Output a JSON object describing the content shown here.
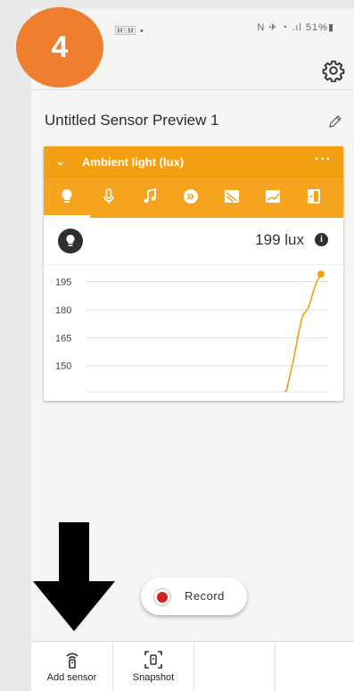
{
  "step_badge": "4",
  "status_bar": {
    "left": "🄼🄼 •",
    "right": "N ✈ ◔ .ıl 51%▮"
  },
  "preview": {
    "title": "Untitled Sensor Preview 1"
  },
  "sensor_card": {
    "title": "Ambient light (lux)",
    "more": "···",
    "tabs": [
      "light-bulb-icon",
      "microphone-icon",
      "music-note-icon",
      "pitch-icon",
      "linear-accel-icon",
      "accelerometer-icon",
      "magnetometer-icon"
    ],
    "reading": "199 lux",
    "info": "i"
  },
  "chart_data": {
    "type": "line",
    "title": "",
    "xlabel": "",
    "ylabel": "",
    "yticks": [
      "195",
      "180",
      "165",
      "150"
    ],
    "ylim": [
      136,
      201
    ],
    "grid": true,
    "series": [
      {
        "color": "#f29f12",
        "x": [
          0,
          1,
          2,
          3,
          4,
          5,
          6,
          7,
          8,
          9,
          10,
          11,
          12,
          13,
          14,
          15,
          16,
          17
        ],
        "y": [
          136,
          137,
          142,
          147,
          152,
          158,
          164,
          170,
          175,
          178,
          179,
          181,
          184,
          188,
          192,
          195,
          197,
          199
        ]
      }
    ],
    "last_point_marker": true
  },
  "record": {
    "label": "Record",
    "color": "#d81f1f"
  },
  "bottom_nav": [
    {
      "label": "Add sensor",
      "icon": "sensor-icon"
    },
    {
      "label": "Snapshot",
      "icon": "snapshot-icon"
    }
  ],
  "colors": {
    "accent": "#f29f12",
    "badge": "#ef7f2f"
  }
}
